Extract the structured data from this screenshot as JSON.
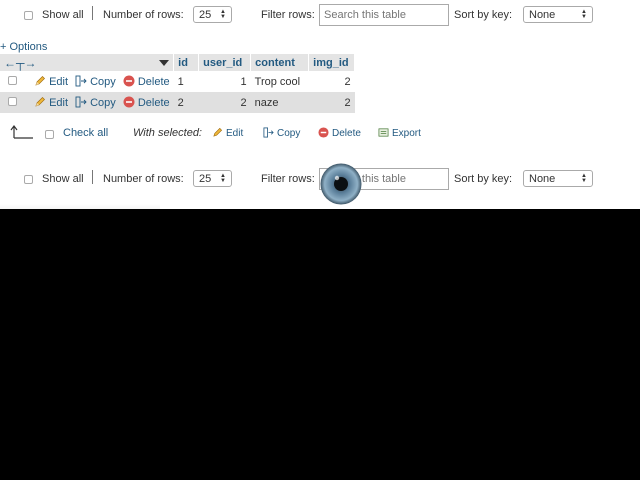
{
  "nav_top": {
    "show_all": "Show all",
    "rows_label": "Number of rows:",
    "rows_value": "25",
    "filter_label": "Filter rows:",
    "filter_placeholder": "Search this table",
    "sort_label": "Sort by key:",
    "sort_value": "None"
  },
  "options_link": "+ Options",
  "table": {
    "headers": [
      "id",
      "user_id",
      "content",
      "img_id"
    ],
    "actions": {
      "edit": "Edit",
      "copy": "Copy",
      "delete": "Delete"
    },
    "rows": [
      {
        "id": "1",
        "user_id": "1",
        "content": "Trop cool",
        "img_id": "2"
      },
      {
        "id": "2",
        "user_id": "2",
        "content": "naze",
        "img_id": "2"
      }
    ]
  },
  "bulk": {
    "check_all": "Check all",
    "with_selected": "With selected:",
    "edit": "Edit",
    "copy": "Copy",
    "delete": "Delete",
    "export": "Export"
  },
  "nav_bottom": {
    "show_all": "Show all",
    "rows_label": "Number of rows:",
    "rows_value": "25",
    "filter_label": "Filter rows:",
    "filter_placeholder": "Search this table",
    "sort_label": "Sort by key:",
    "sort_value": "None"
  },
  "colors": {
    "link": "#235a81",
    "header_bg": "#e4e4e4",
    "row_alt": "#e0e0e0",
    "delete_red": "#d9534f"
  }
}
